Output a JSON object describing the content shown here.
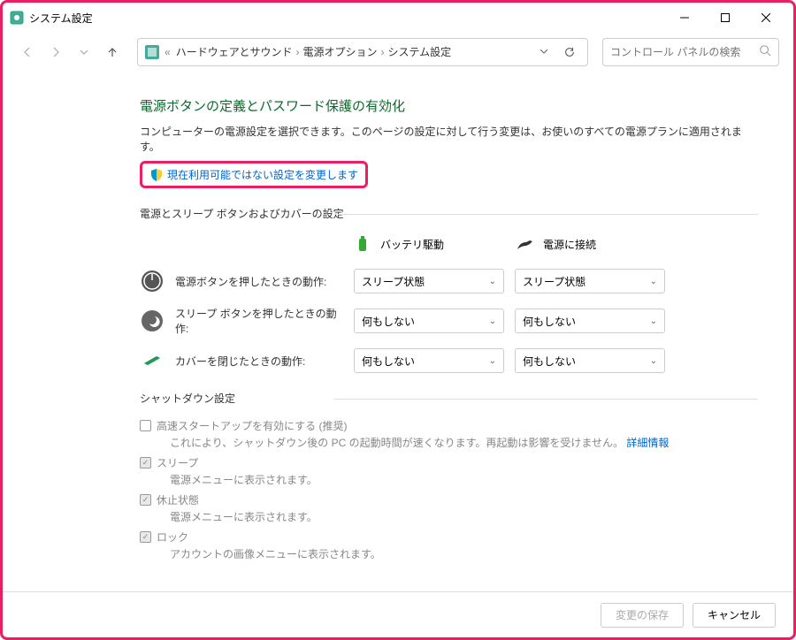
{
  "window": {
    "title": "システム設定"
  },
  "breadcrumb": {
    "item1": "ハードウェアとサウンド",
    "item2": "電源オプション",
    "item3": "システム設定"
  },
  "search": {
    "placeholder": "コントロール パネルの検索"
  },
  "page": {
    "title": "電源ボタンの定義とパスワード保護の有効化",
    "desc": "コンピューターの電源設定を選択できます。このページの設定に対して行う変更は、お使いのすべての電源プランに適用されます。",
    "change_settings_link": "現在利用可能ではない設定を変更します"
  },
  "section1": {
    "header": "電源とスリープ ボタンおよびカバーの設定",
    "col_battery": "バッテリ駆動",
    "col_plugged": "電源に接続",
    "row_power": {
      "label": "電源ボタンを押したときの動作:",
      "battery": "スリープ状態",
      "plugged": "スリープ状態"
    },
    "row_sleep": {
      "label": "スリープ ボタンを押したときの動作:",
      "battery": "何もしない",
      "plugged": "何もしない"
    },
    "row_lid": {
      "label": "カバーを閉じたときの動作:",
      "battery": "何もしない",
      "plugged": "何もしない"
    }
  },
  "section2": {
    "header": "シャットダウン設定",
    "fast_startup": {
      "label": "高速スタートアップを有効にする (推奨)",
      "desc": "これにより、シャットダウン後の PC の起動時間が速くなります。再起動は影響を受けません。",
      "link": "詳細情報"
    },
    "sleep": {
      "label": "スリープ",
      "desc": "電源メニューに表示されます。"
    },
    "hibernate": {
      "label": "休止状態",
      "desc": "電源メニューに表示されます。"
    },
    "lock": {
      "label": "ロック",
      "desc": "アカウントの画像メニューに表示されます。"
    }
  },
  "footer": {
    "save": "変更の保存",
    "cancel": "キャンセル"
  }
}
